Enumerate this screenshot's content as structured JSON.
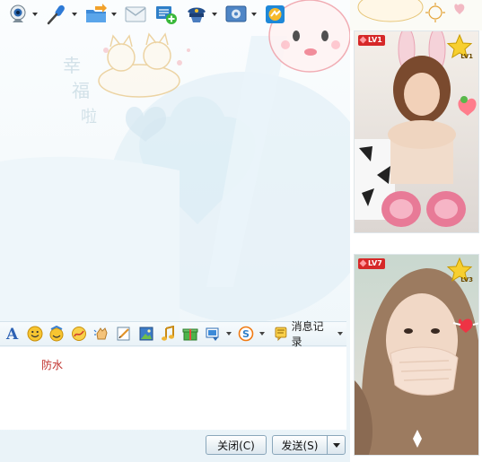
{
  "toolbar": {
    "items": [
      {
        "name": "video-call",
        "icon": "webcam-icon",
        "has_dropdown": true
      },
      {
        "name": "voice-call",
        "icon": "microphone-icon",
        "has_dropdown": true
      },
      {
        "name": "send-file",
        "icon": "folder-transfer-icon",
        "has_dropdown": true
      },
      {
        "name": "send-mail",
        "icon": "mail-icon",
        "has_dropdown": false
      },
      {
        "name": "create-discussion",
        "icon": "add-group-icon",
        "has_dropdown": false
      },
      {
        "name": "remote-assist",
        "icon": "police-cap-icon",
        "has_dropdown": true
      },
      {
        "name": "apps",
        "icon": "settings-panel-icon",
        "has_dropdown": true
      },
      {
        "name": "share-screen",
        "icon": "arrow-share-icon",
        "has_dropdown": false
      }
    ]
  },
  "format_toolbar": {
    "icons": [
      "font-icon",
      "smiley-icon",
      "magic-face-icon",
      "scribble-icon",
      "shake-icon",
      "edit-icon",
      "image-icon",
      "music-note-icon",
      "gift-icon",
      "screenshot-icon",
      "sogou-input-icon"
    ],
    "history_label": "消息记录"
  },
  "input": {
    "text": "防水",
    "text_color": "#c0302b"
  },
  "buttons": {
    "close": "关闭(C)",
    "send": "发送(S)"
  },
  "show_panel": {
    "cards": [
      {
        "level": "LV1",
        "star_level": "LV1"
      },
      {
        "level": "LV7",
        "star_level": "LV3"
      }
    ]
  },
  "colors": {
    "accent_blue": "#2f7fc8",
    "badge_red": "#d62828",
    "skin_bg": "#f2f8fb"
  }
}
